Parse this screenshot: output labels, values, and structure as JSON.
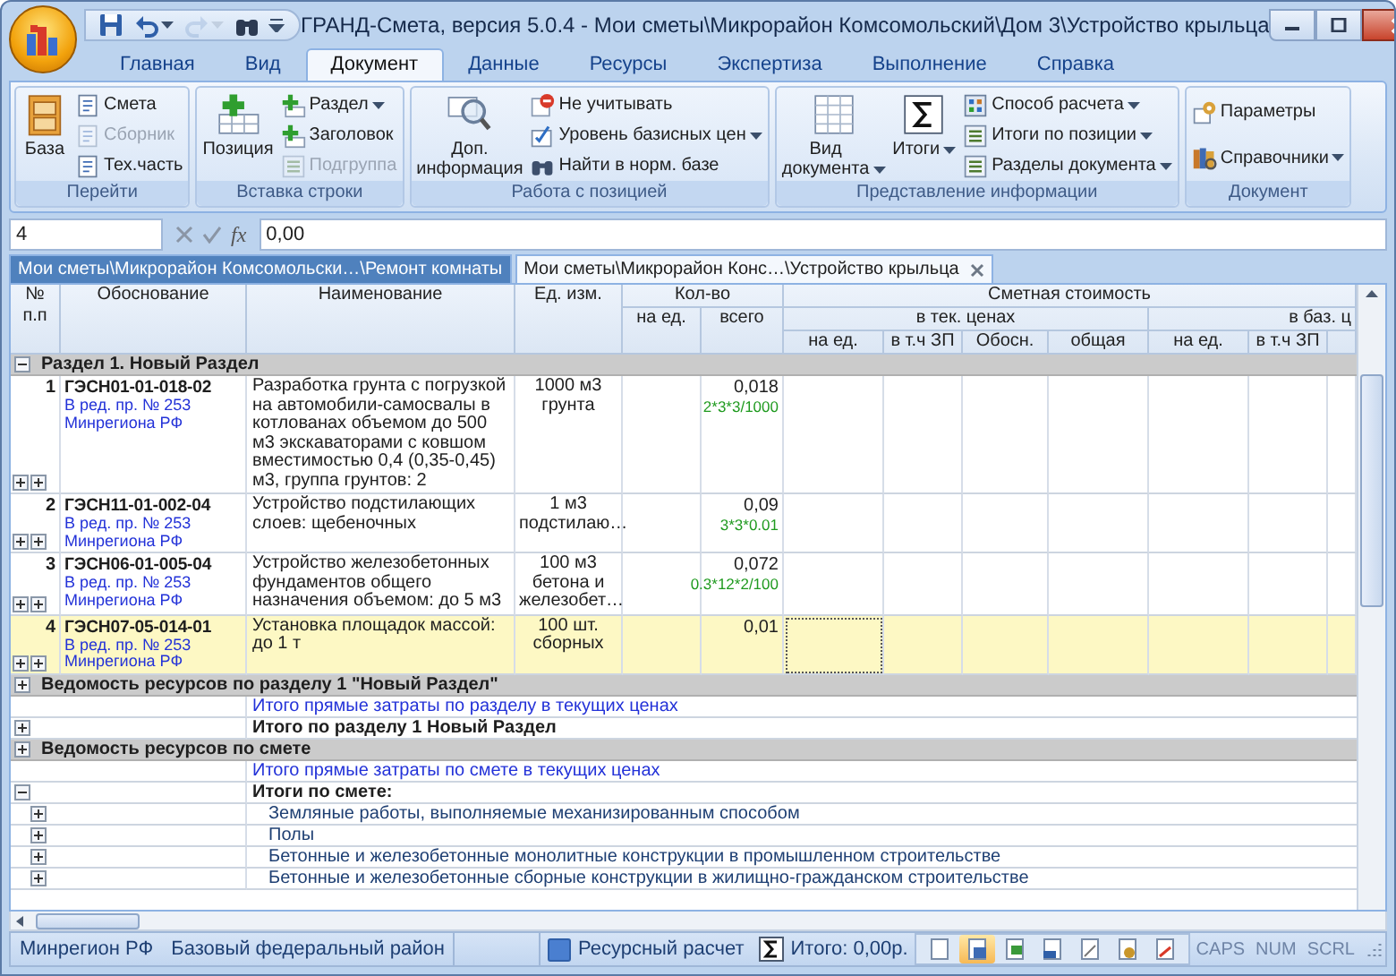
{
  "window": {
    "title": "ГРАНД-Смета, версия 5.0.4 - Мои сметы\\Микрорайон Комсомольский\\Дом 3\\Устройство крыльца"
  },
  "quick_access": [
    {
      "disabled": false
    },
    {
      "disabled": false
    },
    {
      "disabled": true
    },
    {
      "disabled": false
    }
  ],
  "ribbon": {
    "tabs": [
      {
        "label": "Главная",
        "selected": false
      },
      {
        "label": "Вид",
        "selected": false
      },
      {
        "label": "Документ",
        "selected": true
      },
      {
        "label": "Данные",
        "selected": false
      },
      {
        "label": "Ресурсы",
        "selected": false
      },
      {
        "label": "Экспертиза",
        "selected": false
      },
      {
        "label": "Выполнение",
        "selected": false
      },
      {
        "label": "Справка",
        "selected": false
      }
    ],
    "groups": [
      {
        "label": "Перейти",
        "items": [
          {
            "kind": "large",
            "label": "База",
            "disabled": false,
            "dropdown": false
          },
          {
            "kind": "small",
            "label": "Смета",
            "disabled": false,
            "dropdown": false
          },
          {
            "kind": "small",
            "label": "Сборник",
            "disabled": true,
            "dropdown": false
          },
          {
            "kind": "small",
            "label": "Тех.часть",
            "disabled": false,
            "dropdown": false
          }
        ]
      },
      {
        "label": "Вставка строки",
        "items": [
          {
            "kind": "large",
            "label": "Позиция",
            "disabled": false,
            "dropdown": false
          },
          {
            "kind": "small",
            "label": "Раздел",
            "disabled": false,
            "dropdown": true
          },
          {
            "kind": "small",
            "label": "Заголовок",
            "disabled": false,
            "dropdown": false
          },
          {
            "kind": "small",
            "label": "Подгруппа",
            "disabled": true,
            "dropdown": false
          }
        ]
      },
      {
        "label": "Работа с позицией",
        "items": [
          {
            "kind": "large",
            "label": "Доп. информация",
            "disabled": false,
            "dropdown": false
          },
          {
            "kind": "small",
            "label": "Не учитывать",
            "disabled": false,
            "dropdown": false
          },
          {
            "kind": "small",
            "label": "Уровень базисных цен",
            "disabled": false,
            "dropdown": true
          },
          {
            "kind": "small",
            "label": "Найти в норм. базе",
            "disabled": false,
            "dropdown": false
          }
        ]
      },
      {
        "label": "Представление информации",
        "items": [
          {
            "kind": "large",
            "label": "Вид документа",
            "disabled": false,
            "dropdown": true
          },
          {
            "kind": "large",
            "label": "Итоги",
            "disabled": false,
            "dropdown": true
          },
          {
            "kind": "small",
            "label": "Способ расчета",
            "disabled": false,
            "dropdown": true
          },
          {
            "kind": "small",
            "label": "Итоги по позиции",
            "disabled": false,
            "dropdown": true
          },
          {
            "kind": "small",
            "label": "Разделы документа",
            "disabled": false,
            "dropdown": true
          }
        ]
      },
      {
        "label": "Документ",
        "items": [
          {
            "kind": "small",
            "label": "Параметры",
            "disabled": false,
            "dropdown": false
          },
          {
            "kind": "small",
            "label": "Справочники",
            "disabled": false,
            "dropdown": true
          }
        ]
      }
    ]
  },
  "formula_bar": {
    "cell": "4",
    "function_button": "fx",
    "value": "0,00"
  },
  "document_tabs": [
    {
      "label": "Мои сметы\\Микрорайон Комсомольски…\\Ремонт комнаты",
      "selected": false
    },
    {
      "label": "Мои сметы\\Микрорайон Конс…\\Устройство крыльца",
      "selected": true
    }
  ],
  "table": {
    "columns": {
      "number": "№ п.п",
      "basis": "Обоснование",
      "name": "Наименование",
      "unit": "Ед. изм.",
      "quantity": "Кол-во",
      "quantity_per_unit": "на ед.",
      "quantity_total": "всего",
      "cost": "Сметная стоимость",
      "current_prices": "в тек. ценах",
      "base_prices": "в баз. ц",
      "current_per_unit": "на ед.",
      "current_wages": "в т.ч ЗП",
      "current_basis": "Обосн.",
      "current_total": "общая",
      "base_per_unit": "на ед.",
      "base_wages": "в т.ч ЗП"
    },
    "rows": [
      {
        "kind": "section",
        "label": "Раздел 1. Новый Раздел",
        "expanded": true
      },
      {
        "kind": "position",
        "number": "1",
        "code": "ГЭСН01-01-018-02",
        "edition": "В ред. пр. № 253",
        "authority": "Минрегиона РФ",
        "name": "Разработка грунта с погрузкой на автомобили-самосвалы в котлованах объемом до 500 м3 экскаваторами с ковшом вместимостью 0,4 (0,35-0,45) м3, группа грунтов: 2",
        "unit": "1000 м3 грунта",
        "quantity_total": "0,018",
        "formula": "2*3*3/1000",
        "selected": false
      },
      {
        "kind": "position",
        "number": "2",
        "code": "ГЭСН11-01-002-04",
        "edition": "В ред. пр. № 253",
        "authority": "Минрегиона РФ",
        "name": "Устройство подстилающих слоев: щебеночных",
        "unit": "1 м3 подстилаю…",
        "quantity_total": "0,09",
        "formula": "3*3*0.01",
        "selected": false
      },
      {
        "kind": "position",
        "number": "3",
        "code": "ГЭСН06-01-005-04",
        "edition": "В ред. пр. № 253",
        "authority": "Минрегиона РФ",
        "name": "Устройство железобетонных фундаментов общего назначения объемом: до 5 м3",
        "unit": "100 м3 бетона и железобет…",
        "quantity_total": "0,072",
        "formula": "0.3*12*2/100",
        "selected": false
      },
      {
        "kind": "position",
        "number": "4",
        "code": "ГЭСН07-05-014-01",
        "edition": "В ред. пр. № 253",
        "authority": "Минрегиона РФ",
        "name": "Установка площадок массой: до 1 т",
        "unit": "100 шт. сборных",
        "quantity_total": "0,01",
        "selected": true
      },
      {
        "kind": "section",
        "label": "Ведомость ресурсов по разделу 1 \"Новый Раздел\"",
        "expanded": false
      },
      {
        "kind": "summary",
        "label": "Итого прямые затраты по разделу в текущих ценах"
      },
      {
        "kind": "total",
        "label": "Итого по разделу 1 Новый Раздел",
        "expanded": false
      },
      {
        "kind": "section",
        "label": "Ведомость ресурсов по смете",
        "expanded": false
      },
      {
        "kind": "summary",
        "label": "Итого прямые затраты по смете в текущих ценах"
      },
      {
        "kind": "total",
        "label": "Итоги по смете:",
        "expanded": true
      },
      {
        "kind": "item",
        "label": "Земляные работы, выполняемые механизированным способом",
        "expanded": false
      },
      {
        "kind": "item",
        "label": "Полы",
        "expanded": false
      },
      {
        "kind": "item",
        "label": "Бетонные и железобетонные монолитные конструкции в промышленном строительстве",
        "expanded": false
      },
      {
        "kind": "item",
        "label": "Бетонные и железобетонные сборные конструкции в жилищно-гражданском строительстве",
        "expanded": false
      }
    ]
  },
  "status_bar": {
    "region": "Минрегион РФ",
    "zone": "Базовый федеральный район",
    "calculation_mode": "Ресурсный расчет",
    "total": "Итого: 0,00р.",
    "tools": [
      {
        "selected": false
      },
      {
        "selected": true
      },
      {
        "selected": false
      },
      {
        "selected": false
      },
      {
        "selected": false
      },
      {
        "selected": false
      },
      {
        "selected": false
      }
    ],
    "indicators": [
      {
        "label": "CAPS",
        "disabled": true
      },
      {
        "label": "NUM",
        "disabled": true
      },
      {
        "label": "SCRL",
        "disabled": true
      }
    ]
  }
}
